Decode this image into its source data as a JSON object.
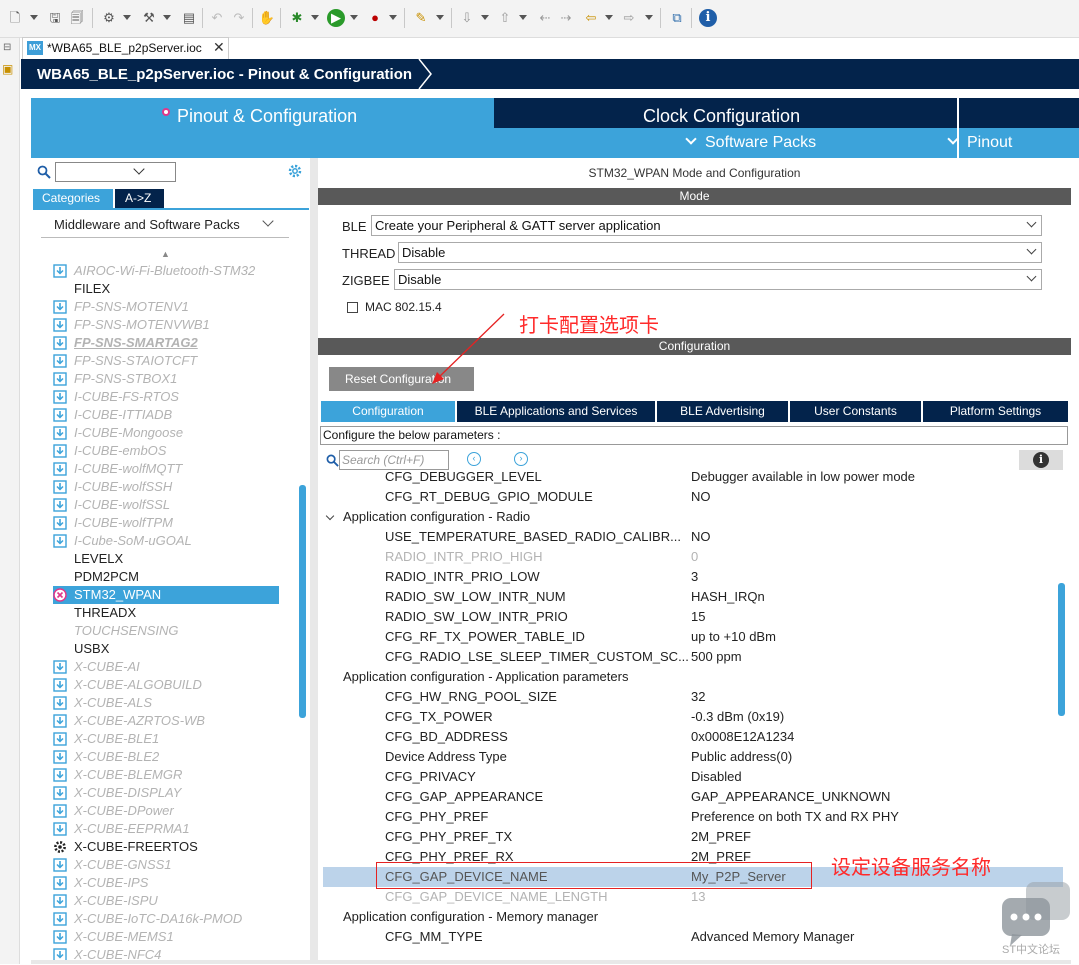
{
  "toolbar": {
    "icons": [
      "new-icon",
      "save-icon",
      "save-all-icon",
      "settings-icon",
      "build-icon",
      "binary-icon",
      "debug-icon",
      "bug-icon",
      "run-icon",
      "external-tool-icon",
      "pen-icon",
      "nav-icon",
      "back-icon",
      "forward-icon",
      "export-icon",
      "info-icon"
    ]
  },
  "editor_tab": {
    "badge": "MX",
    "label": "*WBA65_BLE_p2pServer.ioc",
    "close": "✕"
  },
  "title_bar": {
    "label": "WBA65_BLE_p2pServer.ioc - Pinout & Configuration"
  },
  "main_tabs": {
    "pinout": "Pinout & Configuration",
    "clock": "Clock Configuration",
    "software_packs": "Software Packs",
    "pinout_menu": "Pinout"
  },
  "left_panel": {
    "search_placeholder": "",
    "tab_categories": "Categories",
    "tab_az": "A->Z",
    "section": "Middleware and Software Packs",
    "packs": [
      {
        "label": "AIROC-Wi-Fi-Bluetooth-STM32",
        "state": "dis",
        "icon": "download-icon"
      },
      {
        "label": "FILEX",
        "state": "en",
        "icon": ""
      },
      {
        "label": "FP-SNS-MOTENV1",
        "state": "dis",
        "icon": "download-icon"
      },
      {
        "label": "FP-SNS-MOTENVWB1",
        "state": "dis",
        "icon": "download-icon"
      },
      {
        "label": "FP-SNS-SMARTAG2",
        "state": "dis bold",
        "icon": "download-icon"
      },
      {
        "label": "FP-SNS-STAIOTCFT",
        "state": "dis",
        "icon": "download-icon"
      },
      {
        "label": "FP-SNS-STBOX1",
        "state": "dis",
        "icon": "download-icon"
      },
      {
        "label": "I-CUBE-FS-RTOS",
        "state": "dis",
        "icon": "download-icon"
      },
      {
        "label": "I-CUBE-ITTIADB",
        "state": "dis",
        "icon": "download-icon"
      },
      {
        "label": "I-CUBE-Mongoose",
        "state": "dis",
        "icon": "download-icon"
      },
      {
        "label": "I-CUBE-embOS",
        "state": "dis",
        "icon": "download-icon"
      },
      {
        "label": "I-CUBE-wolfMQTT",
        "state": "dis",
        "icon": "download-icon"
      },
      {
        "label": "I-CUBE-wolfSSH",
        "state": "dis",
        "icon": "download-icon"
      },
      {
        "label": "I-CUBE-wolfSSL",
        "state": "dis",
        "icon": "download-icon"
      },
      {
        "label": "I-CUBE-wolfTPM",
        "state": "dis",
        "icon": "download-icon"
      },
      {
        "label": "I-Cube-SoM-uGOAL",
        "state": "dis",
        "icon": "download-icon"
      },
      {
        "label": "LEVELX",
        "state": "en",
        "icon": ""
      },
      {
        "label": "PDM2PCM",
        "state": "en",
        "icon": ""
      },
      {
        "label": "STM32_WPAN",
        "state": "sel",
        "icon": "error-icon"
      },
      {
        "label": "THREADX",
        "state": "en",
        "icon": ""
      },
      {
        "label": "TOUCHSENSING",
        "state": "dis",
        "icon": ""
      },
      {
        "label": "USBX",
        "state": "en",
        "icon": ""
      },
      {
        "label": "X-CUBE-AI",
        "state": "dis",
        "icon": "download-icon"
      },
      {
        "label": "X-CUBE-ALGOBUILD",
        "state": "dis",
        "icon": "download-icon"
      },
      {
        "label": "X-CUBE-ALS",
        "state": "dis",
        "icon": "download-icon"
      },
      {
        "label": "X-CUBE-AZRTOS-WB",
        "state": "dis",
        "icon": "download-icon"
      },
      {
        "label": "X-CUBE-BLE1",
        "state": "dis",
        "icon": "download-icon"
      },
      {
        "label": "X-CUBE-BLE2",
        "state": "dis",
        "icon": "download-icon"
      },
      {
        "label": "X-CUBE-BLEMGR",
        "state": "dis",
        "icon": "download-icon"
      },
      {
        "label": "X-CUBE-DISPLAY",
        "state": "dis",
        "icon": "download-icon"
      },
      {
        "label": "X-CUBE-DPower",
        "state": "dis",
        "icon": "download-icon"
      },
      {
        "label": "X-CUBE-EEPRMA1",
        "state": "dis",
        "icon": "download-icon"
      },
      {
        "label": "X-CUBE-FREERTOS",
        "state": "en",
        "icon": "gear-icon"
      },
      {
        "label": "X-CUBE-GNSS1",
        "state": "dis",
        "icon": "download-icon"
      },
      {
        "label": "X-CUBE-IPS",
        "state": "dis",
        "icon": "download-icon"
      },
      {
        "label": "X-CUBE-ISPU",
        "state": "dis",
        "icon": "download-icon"
      },
      {
        "label": "X-CUBE-IoTC-DA16k-PMOD",
        "state": "dis",
        "icon": "download-icon"
      },
      {
        "label": "X-CUBE-MEMS1",
        "state": "dis",
        "icon": "download-icon"
      },
      {
        "label": "X-CUBE-NFC4",
        "state": "dis",
        "icon": "download-icon"
      }
    ]
  },
  "right_panel": {
    "title": "STM32_WPAN Mode and Configuration",
    "mode_header": "Mode",
    "mode_rows": [
      {
        "label": "BLE",
        "value": "Create your Peripheral & GATT server application"
      },
      {
        "label": "THREAD",
        "value": "Disable"
      },
      {
        "label": "ZIGBEE",
        "value": "Disable"
      }
    ],
    "mac_label": "MAC 802.15.4",
    "annotation_tab": "打卡配置选项卡",
    "config_header": "Configuration",
    "reset_button": "Reset Configuration",
    "config_tabs": [
      "Configuration",
      "BLE Applications and Services",
      "BLE Advertising",
      "User Constants",
      "Platform Settings"
    ],
    "config_note": "Configure the below parameters :",
    "search_placeholder": "Search (Ctrl+F)",
    "params": [
      {
        "name": "CFG_DEBUGGER_LEVEL",
        "value": "Debugger available in low power mode",
        "kind": "p"
      },
      {
        "name": "CFG_RT_DEBUG_GPIO_MODULE",
        "value": "NO",
        "kind": "p"
      },
      {
        "name": "Application configuration - Radio",
        "value": "",
        "kind": "grp"
      },
      {
        "name": "USE_TEMPERATURE_BASED_RADIO_CALIBR...",
        "value": "NO",
        "kind": "p"
      },
      {
        "name": "RADIO_INTR_PRIO_HIGH",
        "value": "0",
        "kind": "dis"
      },
      {
        "name": "RADIO_INTR_PRIO_LOW",
        "value": "3",
        "kind": "p"
      },
      {
        "name": "RADIO_SW_LOW_INTR_NUM",
        "value": "HASH_IRQn",
        "kind": "p"
      },
      {
        "name": "RADIO_SW_LOW_INTR_PRIO",
        "value": "15",
        "kind": "p"
      },
      {
        "name": "CFG_RF_TX_POWER_TABLE_ID",
        "value": "up to +10 dBm",
        "kind": "p"
      },
      {
        "name": "CFG_RADIO_LSE_SLEEP_TIMER_CUSTOM_SC...",
        "value": "500 ppm",
        "kind": "p"
      },
      {
        "name": "Application configuration - Application parameters",
        "value": "",
        "kind": "grp2"
      },
      {
        "name": "CFG_HW_RNG_POOL_SIZE",
        "value": "32",
        "kind": "p"
      },
      {
        "name": "CFG_TX_POWER",
        "value": "-0.3 dBm (0x19)",
        "kind": "p"
      },
      {
        "name": "CFG_BD_ADDRESS",
        "value": "0x0008E12A1234",
        "kind": "p"
      },
      {
        "name": "Device Address Type",
        "value": "Public address(0)",
        "kind": "p"
      },
      {
        "name": "CFG_PRIVACY",
        "value": "Disabled",
        "kind": "p"
      },
      {
        "name": "CFG_GAP_APPEARANCE",
        "value": "GAP_APPEARANCE_UNKNOWN",
        "kind": "p"
      },
      {
        "name": "CFG_PHY_PREF",
        "value": "Preference on both TX and RX PHY",
        "kind": "p"
      },
      {
        "name": "CFG_PHY_PREF_TX",
        "value": "2M_PREF",
        "kind": "p"
      },
      {
        "name": "CFG_PHY_PREF_RX",
        "value": "2M_PREF",
        "kind": "p"
      },
      {
        "name": "CFG_GAP_DEVICE_NAME",
        "value": "My_P2P_Server",
        "kind": "hl"
      },
      {
        "name": "CFG_GAP_DEVICE_NAME_LENGTH",
        "value": "13",
        "kind": "dis"
      },
      {
        "name": "Application configuration - Memory manager",
        "value": "",
        "kind": "grp2"
      },
      {
        "name": "CFG_MM_TYPE",
        "value": "Advanced Memory Manager",
        "kind": "p"
      }
    ],
    "annotation_name": "设定设备服务名称"
  },
  "watermark": {
    "label": "ST中文论坛"
  },
  "colors": {
    "accent": "#3ca3da",
    "navy": "#03234b",
    "annotation": "#ff2a2a",
    "disabled": "#b3b3b3"
  }
}
